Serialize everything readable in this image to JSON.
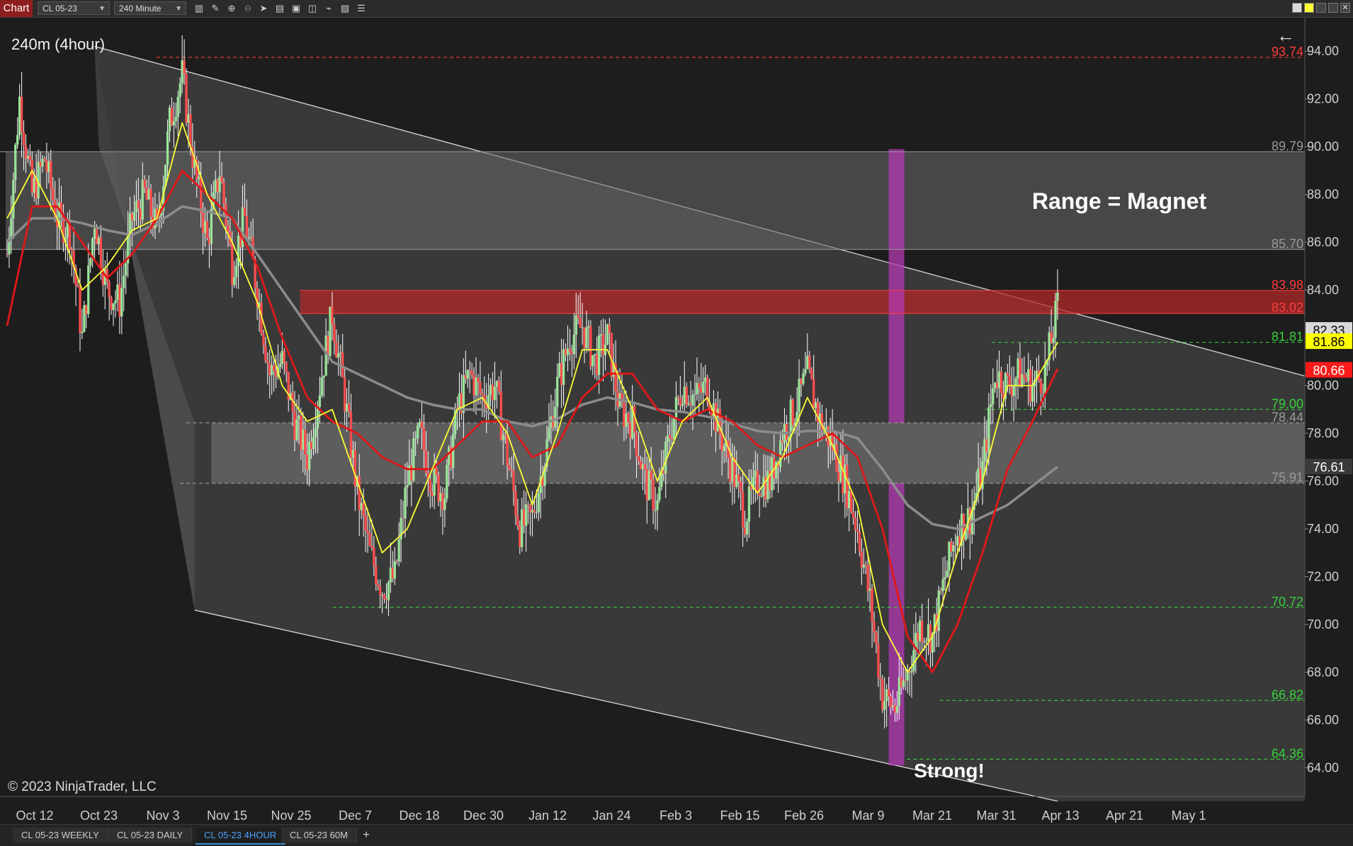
{
  "toolbar": {
    "chart_tab": "Chart",
    "instrument": "CL 05-23",
    "interval": "240 Minute",
    "icons": [
      "bar-style-icon",
      "draw-pencil-icon",
      "zoom-in-icon",
      "zoom-out-icon",
      "pointer-icon",
      "data-box-icon",
      "properties-icon",
      "indicators-icon",
      "strategies-icon",
      "drawing-tools-icon",
      "trade-list-icon"
    ]
  },
  "bottom_tabs": [
    "CL 05-23 WEEKLY",
    "CL 05-23 DAILY",
    "CL 05-23 4HOUR",
    "CL 05-23 60M"
  ],
  "active_tab": 2,
  "chart_data": {
    "type": "candlestick",
    "title": "240m (4hour)",
    "copyright": "© 2023 NinjaTrader, LLC",
    "annotations": {
      "range": "Range = Magnet",
      "strong": "Strong!"
    },
    "ylim": [
      62.8,
      95.4
    ],
    "y_ticks": [
      64,
      66,
      68,
      70,
      72,
      74,
      76,
      78,
      80,
      82,
      84,
      86,
      88,
      90,
      92,
      94
    ],
    "y_tick_labels": [
      "64.00",
      "66.00",
      "68.00",
      "70.00",
      "72.00",
      "74.00",
      "76.00",
      "78.00",
      "80.00",
      "82.00",
      "84.00",
      "86.00",
      "88.00",
      "90.00",
      "92.00",
      "94.00"
    ],
    "x_labels": [
      "Oct 12",
      "Oct 23",
      "Nov 3",
      "Nov 15",
      "Nov 25",
      "Dec 7",
      "Dec 18",
      "Dec 30",
      "Jan 12",
      "Jan 24",
      "Feb 3",
      "Feb 15",
      "Feb 26",
      "Mar 9",
      "Mar 21",
      "Mar 31",
      "Apr 13",
      "Apr 21",
      "May 1"
    ],
    "price_path": [
      [
        0,
        85.5
      ],
      [
        3,
        92
      ],
      [
        6,
        88
      ],
      [
        9,
        89.5
      ],
      [
        12,
        87
      ],
      [
        15,
        86.5
      ],
      [
        18,
        82
      ],
      [
        21,
        87
      ],
      [
        24,
        84
      ],
      [
        27,
        83.5
      ],
      [
        30,
        87
      ],
      [
        33,
        88
      ],
      [
        36,
        86.5
      ],
      [
        39,
        91
      ],
      [
        42,
        93
      ],
      [
        45,
        89
      ],
      [
        48,
        86
      ],
      [
        51,
        89
      ],
      [
        54,
        85
      ],
      [
        57,
        87
      ],
      [
        60,
        84
      ],
      [
        63,
        80.5
      ],
      [
        66,
        81
      ],
      [
        69,
        78.5
      ],
      [
        72,
        77
      ],
      [
        75,
        80
      ],
      [
        78,
        83
      ],
      [
        81,
        79.5
      ],
      [
        84,
        75.5
      ],
      [
        87,
        73
      ],
      [
        90,
        71.5
      ],
      [
        93,
        72
      ],
      [
        96,
        76
      ],
      [
        99,
        78
      ],
      [
        102,
        76
      ],
      [
        105,
        75.5
      ],
      [
        108,
        79
      ],
      [
        111,
        80.5
      ],
      [
        114,
        79.5
      ],
      [
        117,
        80
      ],
      [
        120,
        77
      ],
      [
        123,
        74
      ],
      [
        126,
        74.5
      ],
      [
        129,
        77
      ],
      [
        132,
        80
      ],
      [
        135,
        82
      ],
      [
        138,
        82.5
      ],
      [
        141,
        81
      ],
      [
        144,
        82
      ],
      [
        147,
        79
      ],
      [
        150,
        78.5
      ],
      [
        153,
        76
      ],
      [
        156,
        75
      ],
      [
        159,
        78
      ],
      [
        162,
        80
      ],
      [
        165,
        79.5
      ],
      [
        168,
        80
      ],
      [
        171,
        78
      ],
      [
        174,
        76.5
      ],
      [
        177,
        74.5
      ],
      [
        180,
        76
      ],
      [
        183,
        76
      ],
      [
        186,
        78
      ],
      [
        189,
        79
      ],
      [
        192,
        80.5
      ],
      [
        195,
        78.5
      ],
      [
        198,
        77.5
      ],
      [
        201,
        76
      ],
      [
        204,
        74
      ],
      [
        207,
        71
      ],
      [
        210,
        67
      ],
      [
        213,
        66.5
      ],
      [
        216,
        68
      ],
      [
        219,
        70
      ],
      [
        222,
        69.5
      ],
      [
        225,
        72
      ],
      [
        228,
        74
      ],
      [
        231,
        74.5
      ],
      [
        234,
        76.5
      ],
      [
        237,
        80.5
      ],
      [
        240,
        80
      ],
      [
        243,
        80.5
      ],
      [
        246,
        80
      ],
      [
        249,
        80.5
      ],
      [
        252,
        83.3
      ]
    ],
    "ema_fast": [
      [
        0,
        87
      ],
      [
        6,
        89
      ],
      [
        12,
        87
      ],
      [
        18,
        84
      ],
      [
        24,
        85
      ],
      [
        30,
        86.5
      ],
      [
        36,
        87
      ],
      [
        42,
        91
      ],
      [
        48,
        88
      ],
      [
        54,
        86
      ],
      [
        60,
        83.5
      ],
      [
        66,
        80
      ],
      [
        72,
        78.5
      ],
      [
        78,
        79
      ],
      [
        84,
        76
      ],
      [
        90,
        73
      ],
      [
        96,
        74
      ],
      [
        102,
        76.5
      ],
      [
        108,
        79
      ],
      [
        114,
        79.5
      ],
      [
        120,
        78
      ],
      [
        126,
        75
      ],
      [
        132,
        78
      ],
      [
        138,
        81.5
      ],
      [
        144,
        81.5
      ],
      [
        150,
        79
      ],
      [
        156,
        76
      ],
      [
        162,
        78.5
      ],
      [
        168,
        79.5
      ],
      [
        174,
        77
      ],
      [
        180,
        75.5
      ],
      [
        186,
        77
      ],
      [
        192,
        79.5
      ],
      [
        198,
        77.5
      ],
      [
        204,
        75
      ],
      [
        210,
        70
      ],
      [
        216,
        68
      ],
      [
        222,
        69.5
      ],
      [
        228,
        73
      ],
      [
        234,
        76
      ],
      [
        240,
        80
      ],
      [
        246,
        80
      ],
      [
        252,
        81.8
      ]
    ],
    "ema_mid": [
      [
        0,
        82.5
      ],
      [
        6,
        87.5
      ],
      [
        12,
        87.5
      ],
      [
        18,
        86
      ],
      [
        24,
        84.5
      ],
      [
        30,
        85.5
      ],
      [
        36,
        87
      ],
      [
        42,
        89
      ],
      [
        48,
        88
      ],
      [
        54,
        87
      ],
      [
        60,
        85
      ],
      [
        66,
        82
      ],
      [
        72,
        79.5
      ],
      [
        78,
        78.5
      ],
      [
        84,
        78
      ],
      [
        90,
        77
      ],
      [
        96,
        76.5
      ],
      [
        102,
        76.5
      ],
      [
        108,
        77.5
      ],
      [
        114,
        78.5
      ],
      [
        120,
        78.5
      ],
      [
        126,
        77
      ],
      [
        132,
        77.5
      ],
      [
        138,
        79.5
      ],
      [
        144,
        80.5
      ],
      [
        150,
        80.5
      ],
      [
        156,
        79
      ],
      [
        162,
        78.5
      ],
      [
        168,
        79
      ],
      [
        174,
        78.5
      ],
      [
        180,
        77.5
      ],
      [
        186,
        77
      ],
      [
        192,
        77.5
      ],
      [
        198,
        78
      ],
      [
        204,
        77
      ],
      [
        210,
        74
      ],
      [
        216,
        69.5
      ],
      [
        222,
        68
      ],
      [
        228,
        70
      ],
      [
        234,
        73
      ],
      [
        240,
        76.5
      ],
      [
        246,
        78.5
      ],
      [
        252,
        80.7
      ]
    ],
    "sma_slow": [
      [
        0,
        86
      ],
      [
        6,
        87
      ],
      [
        12,
        87
      ],
      [
        18,
        86.8
      ],
      [
        24,
        86.5
      ],
      [
        30,
        86.3
      ],
      [
        36,
        86.8
      ],
      [
        42,
        87.5
      ],
      [
        48,
        87.3
      ],
      [
        54,
        87
      ],
      [
        60,
        85.5
      ],
      [
        66,
        84
      ],
      [
        72,
        82.5
      ],
      [
        78,
        81
      ],
      [
        84,
        80.5
      ],
      [
        90,
        80
      ],
      [
        96,
        79.5
      ],
      [
        102,
        79.2
      ],
      [
        108,
        79
      ],
      [
        114,
        79
      ],
      [
        120,
        78.5
      ],
      [
        126,
        78.3
      ],
      [
        132,
        78.6
      ],
      [
        138,
        79.2
      ],
      [
        144,
        79.5
      ],
      [
        150,
        79.3
      ],
      [
        156,
        79
      ],
      [
        162,
        78.9
      ],
      [
        168,
        78.7
      ],
      [
        174,
        78.4
      ],
      [
        180,
        78.1
      ],
      [
        186,
        78
      ],
      [
        192,
        78.1
      ],
      [
        198,
        78.1
      ],
      [
        204,
        77.8
      ],
      [
        210,
        76.5
      ],
      [
        216,
        75
      ],
      [
        222,
        74.2
      ],
      [
        228,
        74
      ],
      [
        234,
        74.5
      ],
      [
        240,
        75
      ],
      [
        246,
        75.8
      ],
      [
        252,
        76.6
      ]
    ],
    "bars_total": 300,
    "levels": [
      {
        "value": 93.74,
        "label": "93.74",
        "color": "#ff3b3b",
        "dashed": true,
        "x0": 0.12
      },
      {
        "value": 89.79,
        "label": "89.79",
        "color": "#9a9a9a",
        "dashed": false,
        "x0": 0.0
      },
      {
        "value": 85.7,
        "label": "85.70",
        "color": "#9a9a9a",
        "dashed": false,
        "x0": 0.0
      },
      {
        "value": 83.98,
        "label": "83.98",
        "color": "#ff3b3b",
        "dashed": false,
        "x0": 0.23
      },
      {
        "value": 83.02,
        "label": "83.02",
        "color": "#ff3b3b",
        "dashed": false,
        "x0": 0.23
      },
      {
        "value": 81.81,
        "label": "81.81",
        "color": "#36d13a",
        "dashed": true,
        "x0": 0.76
      },
      {
        "value": 79.0,
        "label": "79.00",
        "color": "#36d13a",
        "dashed": true,
        "x0": 0.755
      },
      {
        "value": 78.44,
        "label": "78.44",
        "color": "#9a9a9a",
        "dashed": true,
        "x0": 0.143
      },
      {
        "value": 75.91,
        "label": "75.91",
        "color": "#9a9a9a",
        "dashed": true,
        "x0": 0.138
      },
      {
        "value": 70.72,
        "label": "70.72",
        "color": "#36d13a",
        "dashed": true,
        "x0": 0.255
      },
      {
        "value": 66.82,
        "label": "66.82",
        "color": "#36d13a",
        "dashed": true,
        "x0": 0.72
      },
      {
        "value": 64.36,
        "label": "64.36",
        "color": "#36d13a",
        "dashed": true,
        "x0": 0.695
      }
    ],
    "price_badges": [
      {
        "value": 82.33,
        "label": "82.33",
        "bg": "#d9d9d9",
        "fg": "#000000"
      },
      {
        "value": 81.86,
        "label": "81.86",
        "bg": "#ffff00",
        "fg": "#000000"
      },
      {
        "value": 80.66,
        "label": "80.66",
        "bg": "#ff1a1a",
        "fg": "#ffffff"
      },
      {
        "value": 76.61,
        "label": "76.61",
        "bg": "#3a3a3a",
        "fg": "#ffffff"
      }
    ],
    "colors": {
      "background": "#1d1d1d",
      "up": "#9ae59a",
      "down": "#ff4d4d",
      "wick": "#ffffff",
      "ema_fast": "#ffff33",
      "ema_mid": "#e01818",
      "sma_slow": "#8c8c8c",
      "range_fill": "#6a6a6a",
      "channel_fill": "#3e3e3e",
      "resistance_fill": "#b02828",
      "highlight": "#b23ab2"
    }
  }
}
